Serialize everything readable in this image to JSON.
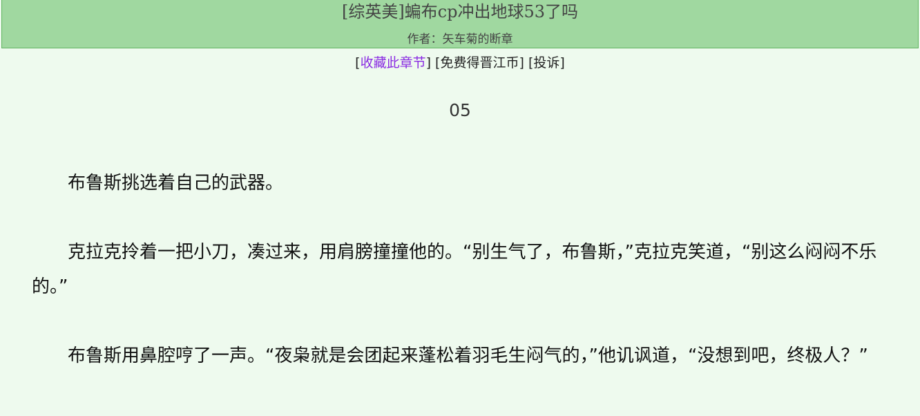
{
  "header": {
    "title": "[综英美]蝙布cp冲出地球53了吗",
    "author_label": "作者：",
    "author_name": "矢车菊的断章"
  },
  "actions": {
    "favorite": "收藏此章节",
    "free_coins": "免费得晋江币",
    "report": "投诉"
  },
  "chapter": {
    "number": "05",
    "paragraphs": [
      "布鲁斯挑选着自己的武器。",
      "克拉克拎着一把小刀，凑过来，用肩膀撞撞他的。“别生气了，布鲁斯，”克拉克笑道，“别这么闷闷不乐的。”",
      "布鲁斯用鼻腔哼了一声。“夜枭就是会团起来蓬松着羽毛生闷气的，”他讥讽道，“没想到吧，终极人？”"
    ]
  },
  "colors": {
    "header_bg": "#a0d8a0",
    "page_bg": "#eefaee",
    "link_accent": "#8a2be2"
  }
}
